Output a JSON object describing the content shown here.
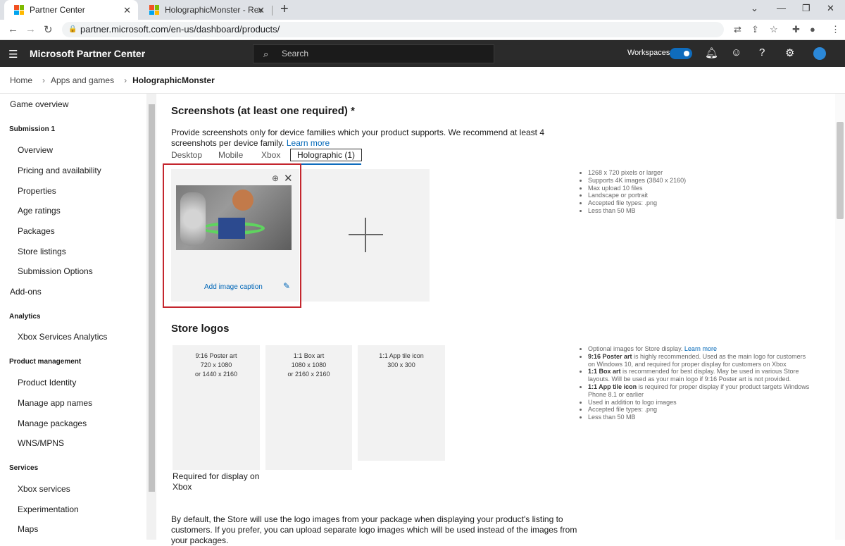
{
  "browser": {
    "tabs": [
      {
        "title": "Partner Center"
      },
      {
        "title": "HolographicMonster - Review Re"
      }
    ],
    "url": "partner.microsoft.com/en-us/dashboard/products/"
  },
  "header": {
    "brand": "Microsoft Partner Center",
    "search_placeholder": "Search",
    "workspaces_label": "Workspaces"
  },
  "breadcrumb": [
    "Home",
    "Apps and games",
    "HolographicMonster"
  ],
  "sidebar": {
    "items": [
      {
        "label": "Game overview",
        "type": "item"
      },
      {
        "label": "Submission 1",
        "type": "heading"
      },
      {
        "label": "Overview",
        "type": "sub"
      },
      {
        "label": "Pricing and availability",
        "type": "sub"
      },
      {
        "label": "Properties",
        "type": "sub"
      },
      {
        "label": "Age ratings",
        "type": "sub"
      },
      {
        "label": "Packages",
        "type": "sub"
      },
      {
        "label": "Store listings",
        "type": "sub"
      },
      {
        "label": "Submission Options",
        "type": "sub"
      },
      {
        "label": "Add-ons",
        "type": "item"
      },
      {
        "label": "Analytics",
        "type": "heading"
      },
      {
        "label": "Xbox Services Analytics",
        "type": "sub"
      },
      {
        "label": "Product management",
        "type": "heading"
      },
      {
        "label": "Product Identity",
        "type": "sub"
      },
      {
        "label": "Manage app names",
        "type": "sub"
      },
      {
        "label": "Manage packages",
        "type": "sub"
      },
      {
        "label": "WNS/MPNS",
        "type": "sub"
      },
      {
        "label": "Services",
        "type": "heading"
      },
      {
        "label": "Xbox services",
        "type": "sub"
      },
      {
        "label": "Experimentation",
        "type": "sub"
      },
      {
        "label": "Maps",
        "type": "sub"
      }
    ]
  },
  "screenshots": {
    "title": "Screenshots (at least one required) *",
    "intro": "Provide screenshots only for device families which your product supports. We recommend at least 4 screenshots per device family.",
    "learn_more": "Learn more",
    "tabs": [
      "Desktop",
      "Mobile",
      "Xbox",
      "Holographic (1)"
    ],
    "caption_link": "Add image caption",
    "requirements": [
      "1268 x 720 pixels or larger",
      "Supports 4K images (3840 x 2160)",
      "Max upload 10 files",
      "Landscape or portrait",
      "Accepted file types: .png",
      "Less than 50 MB"
    ]
  },
  "store_logos": {
    "title": "Store logos",
    "cards": [
      {
        "lines": [
          "9:16 Poster art",
          "720 x 1080",
          "or 1440 x 2160"
        ]
      },
      {
        "lines": [
          "1:1 Box art",
          "1080 x 1080",
          "or 2160 x 2160"
        ]
      },
      {
        "lines": [
          "1:1 App tile icon",
          "300 x 300"
        ]
      }
    ],
    "note": "Required for display on Xbox",
    "info": {
      "optional": "Optional images for Store display.",
      "learn_more": "Learn more",
      "poster_bold": "9:16 Poster art",
      "poster_text": " is highly recommended. Used as the main logo for customers on Windows 10, and required for proper display for customers on Xbox",
      "box_bold": "1:1 Box art",
      "box_text": " is recommended for best display. May be used in various Store layouts. Will be used as your main logo if 9:16 Poster art is not provided.",
      "tile_bold": "1:1 App tile icon",
      "tile_text": " is required for proper display if your product targets Windows Phone 8.1 or earlier",
      "extra": [
        "Used in addition to logo images",
        "Accepted file types: .png",
        "Less than 50 MB"
      ]
    },
    "bottom_text": "By default, the Store will use the logo images from your package when displaying your product's listing to customers. If you prefer, you can upload separate logo images which will be used instead of the images from your packages."
  },
  "colors": {
    "accent": "#0f6cbd",
    "highlight_frame": "#c4262e",
    "header_bg": "#2b2b2b"
  }
}
